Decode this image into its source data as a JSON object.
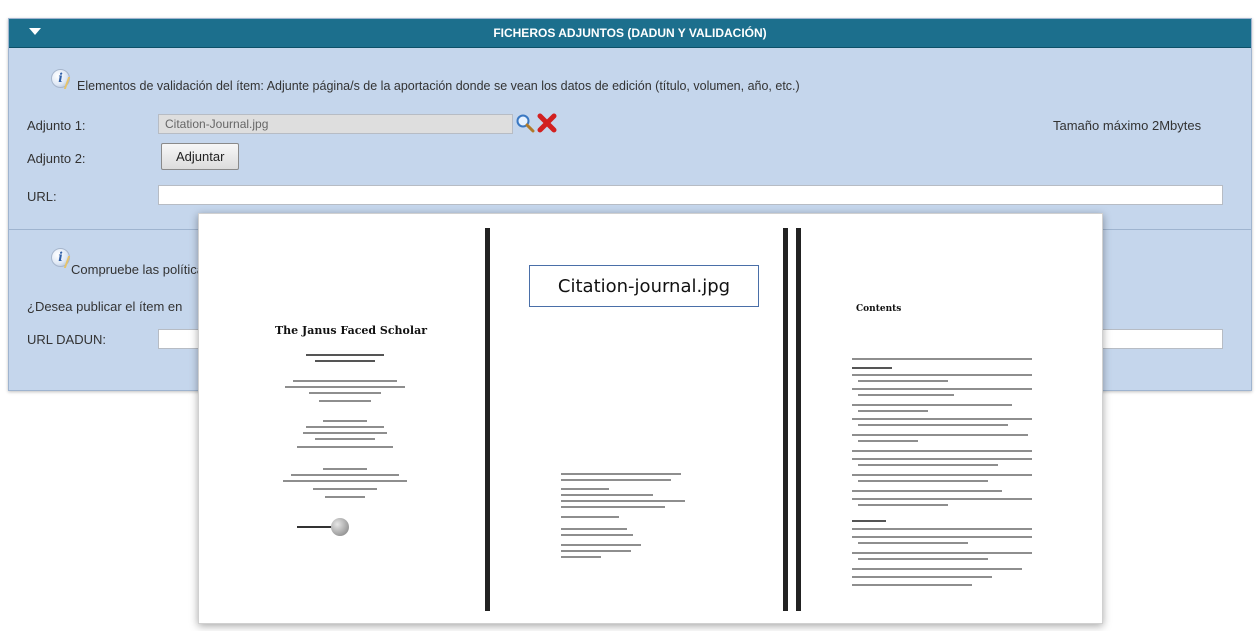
{
  "section": {
    "title": "FICHEROS ADJUNTOS (DADUN Y VALIDACIÓN)",
    "validation_note": "Elementos de validación del ítem: Adjunte página/s de la aportación donde se vean los datos de edición (título, volumen, año, etc.)",
    "adjunto1_label": "Adjunto 1:",
    "adjunto1_value": "Citation-Journal.jpg",
    "max_size": "Tamaño máximo 2Mbytes",
    "adjunto2_label": "Adjunto 2:",
    "adjuntar_button": "Adjuntar",
    "url_label": "URL:",
    "url_value": ""
  },
  "section2": {
    "policy_note": "Compruebe las políticas",
    "publish_question": "¿Desea publicar el ítem en",
    "url_dadun_label": "URL DADUN:",
    "url_dadun_value": ""
  },
  "preview": {
    "caption": "Citation-journal.jpg",
    "page1_title": "The Janus Faced Scholar",
    "page3_title": "Contents"
  },
  "colors": {
    "header": "#1c6f8d",
    "panel": "#c5d6ec",
    "delete": "#d22020"
  },
  "icons": [
    "triangle-down-icon",
    "info-icon",
    "search-icon",
    "delete-icon"
  ]
}
